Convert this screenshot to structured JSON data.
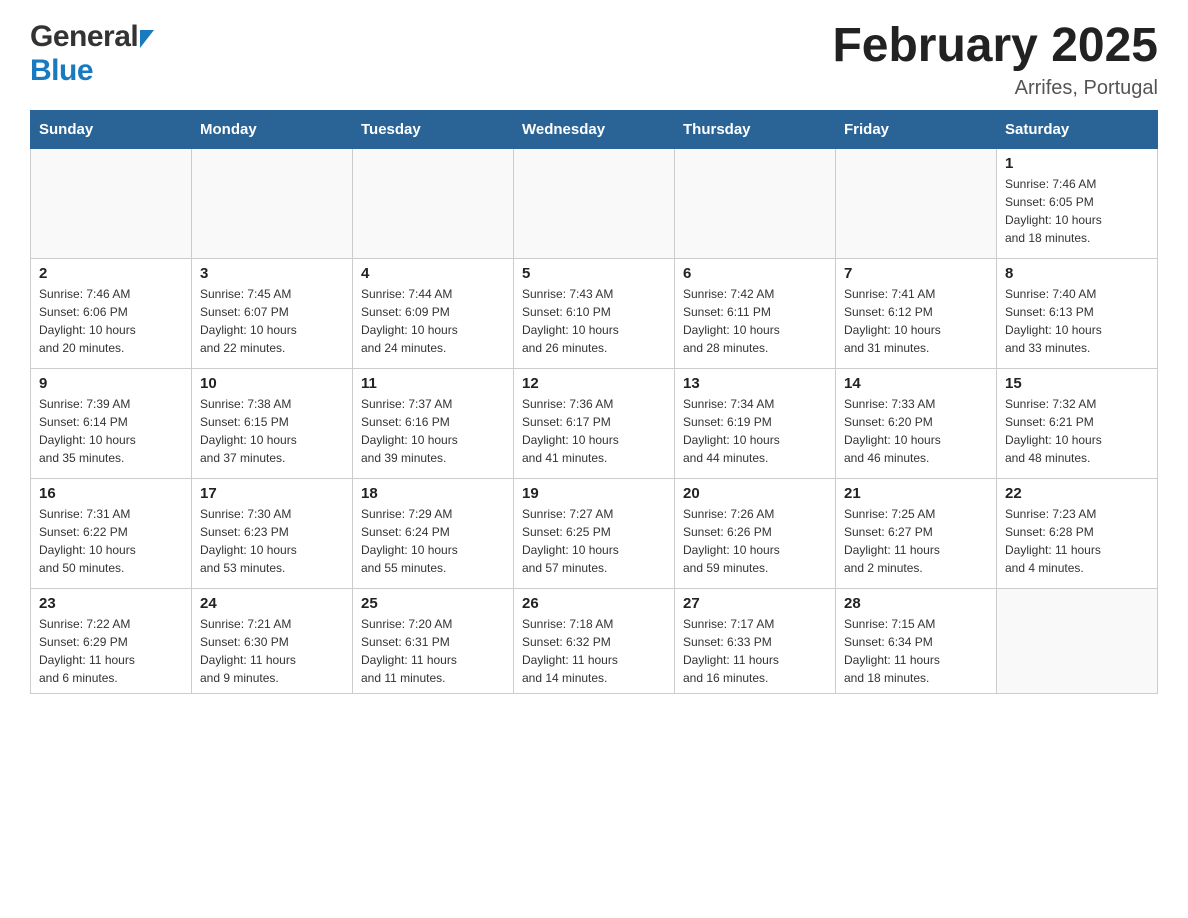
{
  "header": {
    "month_year": "February 2025",
    "location": "Arrifes, Portugal",
    "logo_general": "General",
    "logo_blue": "Blue"
  },
  "days_of_week": [
    "Sunday",
    "Monday",
    "Tuesday",
    "Wednesday",
    "Thursday",
    "Friday",
    "Saturday"
  ],
  "weeks": [
    [
      {
        "day": "",
        "info": ""
      },
      {
        "day": "",
        "info": ""
      },
      {
        "day": "",
        "info": ""
      },
      {
        "day": "",
        "info": ""
      },
      {
        "day": "",
        "info": ""
      },
      {
        "day": "",
        "info": ""
      },
      {
        "day": "1",
        "info": "Sunrise: 7:46 AM\nSunset: 6:05 PM\nDaylight: 10 hours\nand 18 minutes."
      }
    ],
    [
      {
        "day": "2",
        "info": "Sunrise: 7:46 AM\nSunset: 6:06 PM\nDaylight: 10 hours\nand 20 minutes."
      },
      {
        "day": "3",
        "info": "Sunrise: 7:45 AM\nSunset: 6:07 PM\nDaylight: 10 hours\nand 22 minutes."
      },
      {
        "day": "4",
        "info": "Sunrise: 7:44 AM\nSunset: 6:09 PM\nDaylight: 10 hours\nand 24 minutes."
      },
      {
        "day": "5",
        "info": "Sunrise: 7:43 AM\nSunset: 6:10 PM\nDaylight: 10 hours\nand 26 minutes."
      },
      {
        "day": "6",
        "info": "Sunrise: 7:42 AM\nSunset: 6:11 PM\nDaylight: 10 hours\nand 28 minutes."
      },
      {
        "day": "7",
        "info": "Sunrise: 7:41 AM\nSunset: 6:12 PM\nDaylight: 10 hours\nand 31 minutes."
      },
      {
        "day": "8",
        "info": "Sunrise: 7:40 AM\nSunset: 6:13 PM\nDaylight: 10 hours\nand 33 minutes."
      }
    ],
    [
      {
        "day": "9",
        "info": "Sunrise: 7:39 AM\nSunset: 6:14 PM\nDaylight: 10 hours\nand 35 minutes."
      },
      {
        "day": "10",
        "info": "Sunrise: 7:38 AM\nSunset: 6:15 PM\nDaylight: 10 hours\nand 37 minutes."
      },
      {
        "day": "11",
        "info": "Sunrise: 7:37 AM\nSunset: 6:16 PM\nDaylight: 10 hours\nand 39 minutes."
      },
      {
        "day": "12",
        "info": "Sunrise: 7:36 AM\nSunset: 6:17 PM\nDaylight: 10 hours\nand 41 minutes."
      },
      {
        "day": "13",
        "info": "Sunrise: 7:34 AM\nSunset: 6:19 PM\nDaylight: 10 hours\nand 44 minutes."
      },
      {
        "day": "14",
        "info": "Sunrise: 7:33 AM\nSunset: 6:20 PM\nDaylight: 10 hours\nand 46 minutes."
      },
      {
        "day": "15",
        "info": "Sunrise: 7:32 AM\nSunset: 6:21 PM\nDaylight: 10 hours\nand 48 minutes."
      }
    ],
    [
      {
        "day": "16",
        "info": "Sunrise: 7:31 AM\nSunset: 6:22 PM\nDaylight: 10 hours\nand 50 minutes."
      },
      {
        "day": "17",
        "info": "Sunrise: 7:30 AM\nSunset: 6:23 PM\nDaylight: 10 hours\nand 53 minutes."
      },
      {
        "day": "18",
        "info": "Sunrise: 7:29 AM\nSunset: 6:24 PM\nDaylight: 10 hours\nand 55 minutes."
      },
      {
        "day": "19",
        "info": "Sunrise: 7:27 AM\nSunset: 6:25 PM\nDaylight: 10 hours\nand 57 minutes."
      },
      {
        "day": "20",
        "info": "Sunrise: 7:26 AM\nSunset: 6:26 PM\nDaylight: 10 hours\nand 59 minutes."
      },
      {
        "day": "21",
        "info": "Sunrise: 7:25 AM\nSunset: 6:27 PM\nDaylight: 11 hours\nand 2 minutes."
      },
      {
        "day": "22",
        "info": "Sunrise: 7:23 AM\nSunset: 6:28 PM\nDaylight: 11 hours\nand 4 minutes."
      }
    ],
    [
      {
        "day": "23",
        "info": "Sunrise: 7:22 AM\nSunset: 6:29 PM\nDaylight: 11 hours\nand 6 minutes."
      },
      {
        "day": "24",
        "info": "Sunrise: 7:21 AM\nSunset: 6:30 PM\nDaylight: 11 hours\nand 9 minutes."
      },
      {
        "day": "25",
        "info": "Sunrise: 7:20 AM\nSunset: 6:31 PM\nDaylight: 11 hours\nand 11 minutes."
      },
      {
        "day": "26",
        "info": "Sunrise: 7:18 AM\nSunset: 6:32 PM\nDaylight: 11 hours\nand 14 minutes."
      },
      {
        "day": "27",
        "info": "Sunrise: 7:17 AM\nSunset: 6:33 PM\nDaylight: 11 hours\nand 16 minutes."
      },
      {
        "day": "28",
        "info": "Sunrise: 7:15 AM\nSunset: 6:34 PM\nDaylight: 11 hours\nand 18 minutes."
      },
      {
        "day": "",
        "info": ""
      }
    ]
  ]
}
